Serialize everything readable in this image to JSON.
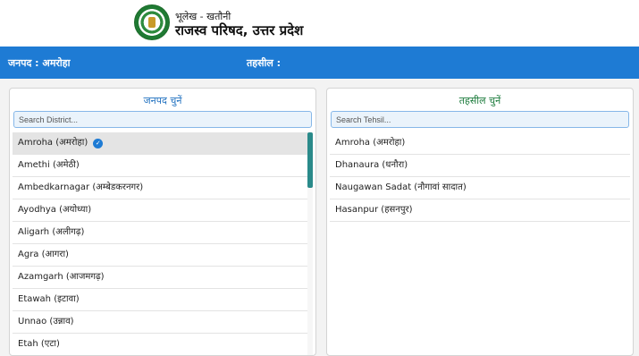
{
  "header": {
    "sub_title": "भूलेख - खतौनी",
    "title": "राजस्व परिषद, उत्तर प्रदेश",
    "logo_icon": "emblem-logo-icon"
  },
  "bar": {
    "district_label": "जनपद : अमरोहा",
    "tehsil_label": "तहसील :",
    "color": "#1e7bd4"
  },
  "district_panel": {
    "title": "जनपद चुनें",
    "search_placeholder": "Search District...",
    "items": [
      {
        "label": "Amroha (अमरोहा)",
        "selected": true
      },
      {
        "label": "Amethi (अमेठी)"
      },
      {
        "label": "Ambedkarnagar (अम्बेडकरनगर)"
      },
      {
        "label": "Ayodhya (अयोध्या)"
      },
      {
        "label": "Aligarh (अलीगढ़)"
      },
      {
        "label": "Agra (आगरा)"
      },
      {
        "label": "Azamgarh (आजमगढ़)"
      },
      {
        "label": "Etawah (इटावा)"
      },
      {
        "label": "Unnao (उन्नाव)"
      },
      {
        "label": "Etah (एटा)"
      }
    ],
    "selected_icon": "check-circle-icon"
  },
  "tehsil_panel": {
    "title": "तहसील चुनें",
    "search_placeholder": "Search Tehsil...",
    "items": [
      {
        "label": "Amroha (अमरोहा)"
      },
      {
        "label": "Dhanaura (धनौरा)"
      },
      {
        "label": "Naugawan Sadat (नौगावां सादात)"
      },
      {
        "label": "Hasanpur (हसनपुर)"
      }
    ]
  }
}
